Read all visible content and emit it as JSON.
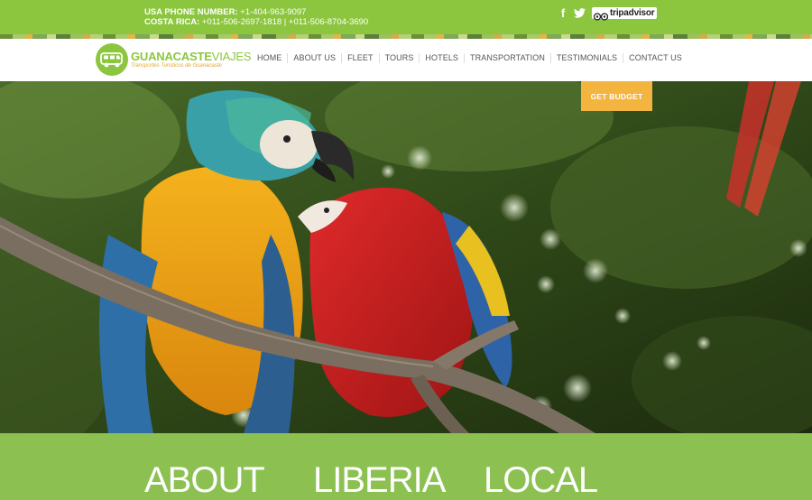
{
  "contact": {
    "usa_label": "USA PHONE NUMBER:",
    "usa_number": "+1-404-963-9097",
    "cr_label": "COSTA RICA:",
    "cr_numbers": "+011-506-2697-1818 | +011-506-8704-3690"
  },
  "social": {
    "facebook_glyph": "f",
    "tripadvisor": "tripadvisor"
  },
  "logo": {
    "name_part1": "GUANACASTE",
    "name_part2": "VIAJES",
    "tagline": "Transportes Turisticos de Guanacaste"
  },
  "nav": {
    "items": [
      "HOME",
      "ABOUT US",
      "FLEET",
      "TOURS",
      "HOTELS",
      "TRANSPORTATION",
      "TESTIMONIALS",
      "CONTACT US"
    ]
  },
  "hero": {
    "cta": "GET BUDGET"
  },
  "sections": {
    "headings": [
      "ABOUT",
      "LIBERIA",
      "LOCAL"
    ]
  },
  "colors": {
    "brand_green": "#8cc63f",
    "accent_orange": "#f3b53f"
  },
  "icons": [
    "facebook-icon",
    "twitter-icon",
    "tripadvisor-logo",
    "van-icon"
  ]
}
